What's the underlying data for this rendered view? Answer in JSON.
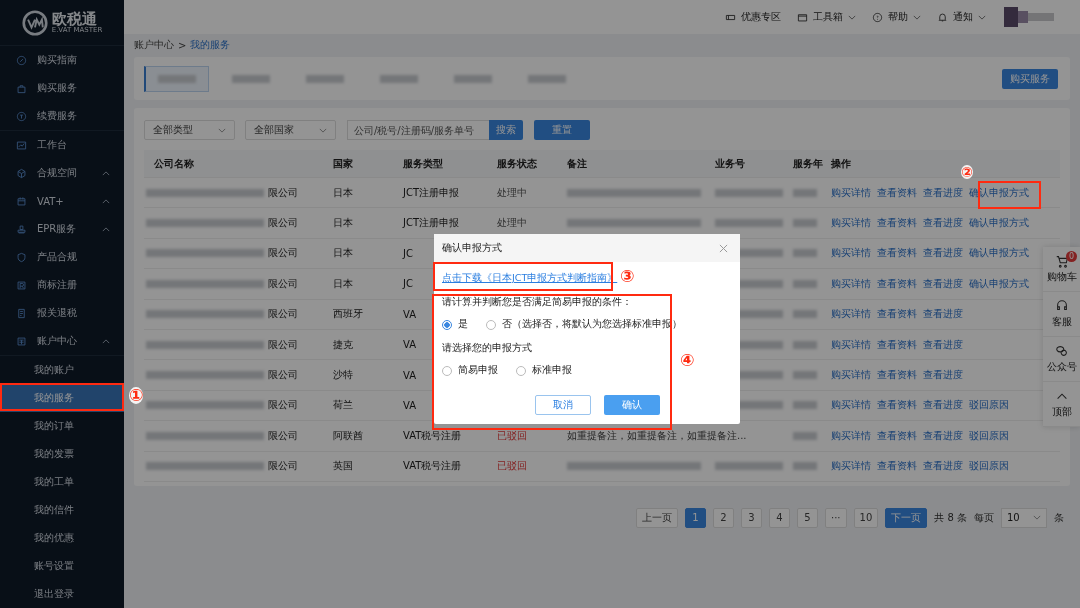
{
  "brand": {
    "name": "欧税通",
    "tagline": "E.VAT MASTER"
  },
  "sidebar": {
    "sections": [
      [
        {
          "label": "购买指南"
        },
        {
          "label": "购买服务"
        },
        {
          "label": "续费服务"
        }
      ],
      [
        {
          "label": "工作台"
        },
        {
          "label": "合规空间",
          "submenu": true
        },
        {
          "label": "VAT+",
          "submenu": true
        },
        {
          "label": "EPR服务",
          "submenu": true
        },
        {
          "label": "产品合规"
        },
        {
          "label": "商标注册"
        },
        {
          "label": "报关退税"
        },
        {
          "label": "账户中心",
          "submenu": true,
          "children": [
            {
              "label": "我的账户",
              "selected": false
            },
            {
              "label": "我的服务",
              "selected": true
            },
            {
              "label": "我的订单",
              "selected": false
            },
            {
              "label": "我的发票",
              "selected": false
            },
            {
              "label": "我的工单",
              "selected": false
            },
            {
              "label": "我的信件",
              "selected": false
            },
            {
              "label": "我的优惠",
              "selected": false
            },
            {
              "label": "账号设置",
              "selected": false
            },
            {
              "label": "退出登录",
              "selected": false
            }
          ]
        }
      ]
    ]
  },
  "top_nav": [
    {
      "label": "优惠专区",
      "menu": false
    },
    {
      "label": "工具箱",
      "menu": true
    },
    {
      "label": "帮助",
      "menu": true
    },
    {
      "label": "通知",
      "menu": true
    }
  ],
  "breadcrumb": {
    "items": [
      "账户中心",
      "我的服务"
    ],
    "separator": ">"
  },
  "tabs": [
    {
      "selected": true
    },
    {
      "selected": false
    },
    {
      "selected": false
    },
    {
      "selected": false
    },
    {
      "selected": false
    },
    {
      "selected": false
    }
  ],
  "buy_button": "购买服务",
  "filters": {
    "type_select": "全部类型",
    "country_select": "全部国家",
    "search_placeholder": "公司/税号/注册码/服务单号",
    "search_button": "搜索",
    "reset_button": "重置"
  },
  "table": {
    "columns": [
      "公司名称",
      "国家",
      "服务类型",
      "服务状态",
      "备注",
      "业务号",
      "服务年",
      "操作"
    ],
    "rows": [
      {
        "company": "限公司",
        "country": "日本",
        "service_type": "JCT注册申报",
        "status": {
          "label": "处理中",
          "kind": "processing"
        },
        "actions": [
          "购买详情",
          "查看资料",
          "查看进度",
          "确认申报方式"
        ]
      },
      {
        "company": "限公司",
        "country": "日本",
        "service_type": "JCT注册申报",
        "status": {
          "label": "处理中",
          "kind": "processing"
        },
        "actions": [
          "购买详情",
          "查看资料",
          "查看进度",
          "确认申报方式"
        ]
      },
      {
        "company": "限公司",
        "country": "日本",
        "service_type": "JC",
        "actions": [
          "购买详情",
          "查看资料",
          "查看进度",
          "确认申报方式"
        ]
      },
      {
        "company": "限公司",
        "country": "日本",
        "service_type": "JC",
        "actions": [
          "购买详情",
          "查看资料",
          "查看进度",
          "确认申报方式"
        ]
      },
      {
        "company": "限公司",
        "country": "西班牙",
        "service_type": "VA",
        "actions": [
          "购买详情",
          "查看资料",
          "查看进度"
        ]
      },
      {
        "company": "限公司",
        "country": "捷克",
        "service_type": "VA",
        "actions": [
          "购买详情",
          "查看资料",
          "查看进度"
        ]
      },
      {
        "company": "限公司",
        "country": "沙特",
        "service_type": "VA",
        "actions": [
          "购买详情",
          "查看资料",
          "查看进度"
        ]
      },
      {
        "company": "限公司",
        "country": "荷兰",
        "service_type": "VA",
        "actions": [
          "购买详情",
          "查看资料",
          "查看进度",
          "驳回原因"
        ]
      },
      {
        "company": "限公司",
        "country": "阿联酋",
        "service_type": "VAT税号注册",
        "status": {
          "label": "已驳回",
          "kind": "rejected"
        },
        "remark": "如重提备注，如重提备注，如重提备注...",
        "actions": [
          "购买详情",
          "查看资料",
          "查看进度",
          "驳回原因"
        ]
      },
      {
        "company": "限公司",
        "country": "英国",
        "service_type": "VAT税号注册",
        "status": {
          "label": "已驳回",
          "kind": "rejected"
        },
        "actions": [
          "购买详情",
          "查看资料",
          "查看进度",
          "驳回原因"
        ]
      }
    ]
  },
  "pagination": {
    "prev": "上一页",
    "pages": [
      {
        "label": "1",
        "selected": true
      },
      {
        "label": "2",
        "selected": false
      },
      {
        "label": "3",
        "selected": false
      },
      {
        "label": "4",
        "selected": false
      },
      {
        "label": "5",
        "selected": false
      },
      {
        "label": "···",
        "selected": false
      },
      {
        "label": "10",
        "selected": false
      }
    ],
    "next": "下一页",
    "total": "共 8 条",
    "per_page_label": "每页",
    "per_page": "10",
    "per_page_unit": "条"
  },
  "float_bar": [
    {
      "label": "购物车",
      "badge": "0"
    },
    {
      "label": "客服"
    },
    {
      "label": "公众号"
    },
    {
      "label": "顶部"
    }
  ],
  "modal": {
    "title": "确认申报方式",
    "download_link": "点击下载《日本JCT申报方式判断指南》",
    "questions": [
      {
        "label": "请计算并判断您是否满足简易申报的条件：",
        "options": [
          {
            "label": "是",
            "selected": true
          },
          {
            "label": "否（选择否，将默认为您选择标准申报）",
            "selected": false
          }
        ]
      },
      {
        "label": "请选择您的申报方式",
        "options": [
          {
            "label": "简易申报",
            "selected": false
          },
          {
            "label": "标准申报",
            "selected": false
          }
        ]
      }
    ],
    "cancel": "取消",
    "confirm": "确认"
  },
  "annotations": [
    {
      "label": "①"
    },
    {
      "label": "②"
    },
    {
      "label": "③"
    },
    {
      "label": "④"
    }
  ]
}
